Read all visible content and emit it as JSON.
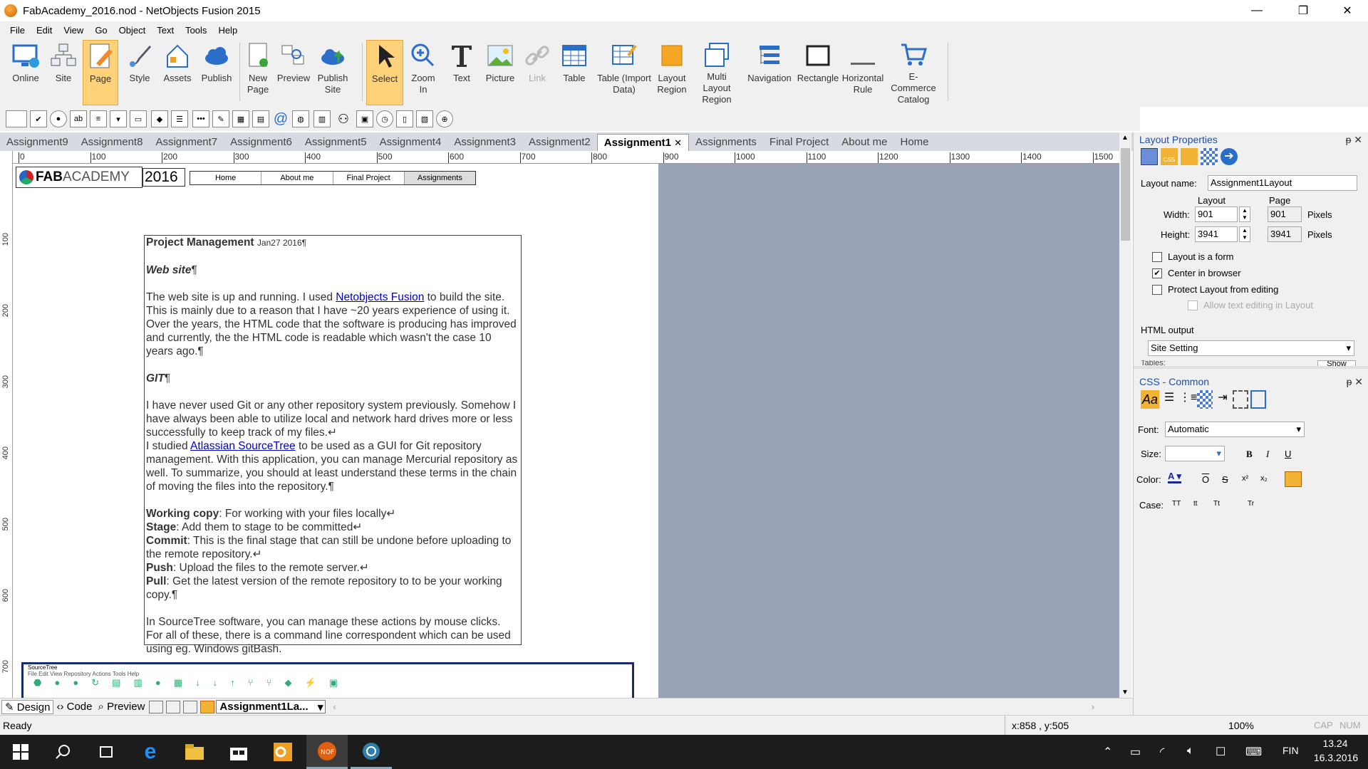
{
  "window": {
    "title": "FabAcademy_2016.nod - NetObjects Fusion 2015",
    "min": "—",
    "max": "❐",
    "close": "✕"
  },
  "menu": [
    "File",
    "Edit",
    "View",
    "Go",
    "Object",
    "Text",
    "Tools",
    "Help"
  ],
  "ribbon": [
    {
      "label": "Online",
      "icon": "monitor-globe-icon"
    },
    {
      "label": "Site",
      "icon": "site-tree-icon"
    },
    {
      "label": "Page",
      "icon": "page-edit-icon",
      "active": true
    },
    {
      "label": "Style",
      "icon": "brush-icon"
    },
    {
      "label": "Assets",
      "icon": "assets-icon"
    },
    {
      "label": "Publish",
      "icon": "cloud-icon"
    },
    {
      "label": "New Page",
      "icon": "new-page-icon"
    },
    {
      "label": "Preview",
      "icon": "preview-icon"
    },
    {
      "label": "Publish Site",
      "icon": "publish-site-icon"
    },
    {
      "label": "Select",
      "icon": "cursor-icon",
      "active": true
    },
    {
      "label": "Zoom In",
      "icon": "zoom-icon"
    },
    {
      "label": "Text",
      "icon": "text-icon"
    },
    {
      "label": "Picture",
      "icon": "picture-icon"
    },
    {
      "label": "Link",
      "icon": "link-icon",
      "disabled": true
    },
    {
      "label": "Table",
      "icon": "table-icon"
    },
    {
      "label": "Table (Import Data)",
      "icon": "table-import-icon"
    },
    {
      "label": "Layout Region",
      "icon": "layout-region-icon"
    },
    {
      "label": "Multi Layout Region",
      "icon": "multi-layout-icon"
    },
    {
      "label": "Navigation",
      "icon": "navigation-icon"
    },
    {
      "label": "Rectangle",
      "icon": "rectangle-icon"
    },
    {
      "label": "Horizontal Rule",
      "icon": "hrule-icon"
    },
    {
      "label": "E-Commerce Catalog",
      "icon": "cart-icon"
    }
  ],
  "tabs": [
    "Assignment9",
    "Assignment8",
    "Assignment7",
    "Assignment6",
    "Assignment5",
    "Assignment4",
    "Assignment3",
    "Assignment2",
    "Assignment1",
    "Assignments",
    "Final Project",
    "About me",
    "Home"
  ],
  "active_tab": "Assignment1",
  "ruler_h": [
    "0",
    "100",
    "200",
    "300",
    "400",
    "500",
    "600",
    "700",
    "800",
    "900",
    "1000",
    "1100",
    "1200",
    "1300",
    "1400",
    "1500"
  ],
  "ruler_v": [
    "100",
    "200",
    "300",
    "400",
    "500",
    "600",
    "700"
  ],
  "page": {
    "logo_fab": "FAB",
    "logo_academy": "ACADEMY",
    "logo_year": "2016",
    "nav": [
      "Home",
      "About me",
      "Final Project",
      "Assignments"
    ],
    "heading": "Project Management",
    "heading_date": "Jan27 2016¶",
    "web_site_h": "Web site",
    "web_p1_a": "The web site is up and running. I used ",
    "web_p1_link": "Netobjects Fusion",
    "web_p1_b": " to build the site. This is mainly due to a reason that I have ~20 years experience of using it. Over the years, the HTML code that the software is producing has improved and currently, the the HTML code is readable which wasn't the case 10 years ago.¶",
    "git_h": "GIT",
    "git_p1": "I have never used Git or any other repository system previously. Somehow I have always been able to utilize local and network hard drives more or less successfully to keep track of my files.↵",
    "git_p2_a": "I studied ",
    "git_p2_link": "Atlassian SourceTree",
    "git_p2_b": " to be used as a GUI for Git repository management. With this application, you can manage Mercurial repository as well. To summarize, you should at least understand these terms in the chain of moving the files into the repository.¶",
    "terms": [
      {
        "t": "Working copy",
        "d": ": For working with your files locally↵"
      },
      {
        "t": "Stage",
        "d": ": Add them to stage to be committed↵"
      },
      {
        "t": "Commit",
        "d": ": This is the final stage that can still be undone before uploading to the remote repository.↵"
      },
      {
        "t": "Push",
        "d": ": Upload the files to the remote server.↵"
      },
      {
        "t": "Pull",
        "d": ": Get the latest version of the remote repository to to be your working copy.¶"
      }
    ],
    "last_p": "In SourceTree software, you can manage these actions by mouse clicks. For all of these, there is a command line correspondent which can be used using eg. Windows gitBash.",
    "screenshot_title": "SourceTree",
    "screenshot_menu": "File  Edit  View  Repository  Actions  Tools  Help"
  },
  "layout_props": {
    "title": "Layout Properties",
    "layout_name_label": "Layout name:",
    "layout_name": "Assignment1Layout",
    "col_layout": "Layout",
    "col_page": "Page",
    "width_label": "Width:",
    "width": "901",
    "width_page": "901",
    "height_label": "Height:",
    "height": "3941",
    "height_page": "3941",
    "unit": "Pixels",
    "form": "Layout is a form",
    "center": "Center in browser",
    "protect": "Protect Layout from editing",
    "allow": "Allow text editing in Layout",
    "html_output": "HTML output",
    "site_setting": "Site Setting",
    "tables_cut": "Tables:",
    "show": "Show"
  },
  "css_common": {
    "title": "CSS - Common",
    "font_label": "Font:",
    "font_value": "Automatic",
    "size_label": "Size:",
    "color_label": "Color:",
    "case_label": "Case:",
    "bold": "B",
    "italic": "I",
    "underline": "U",
    "overline": "O",
    "strike": "S",
    "superscript": "x²",
    "subscript": "x₂",
    "case_options": [
      "TT",
      "tt",
      "Tt",
      "Tr"
    ]
  },
  "viewbar": {
    "design": "Design",
    "code": "Code",
    "preview": "Preview",
    "layout": "Assignment1La..."
  },
  "status": {
    "ready": "Ready",
    "coords": "x:858 , y:505",
    "zoom": "100%",
    "cap": "CAP",
    "num": "NUM"
  },
  "taskbar": {
    "lang": "FIN",
    "time": "13.24",
    "date": "16.3.2016"
  },
  "colors": {
    "accent": "#1f4ea3",
    "active_tab_bg": "#ffd27a",
    "canvas_bg": "#9aa2b8",
    "taskbar": "#1c1c1c"
  }
}
